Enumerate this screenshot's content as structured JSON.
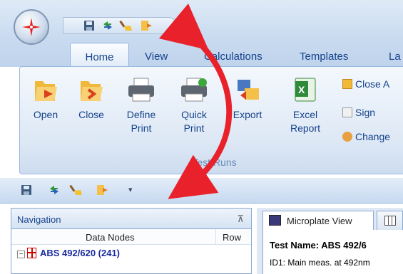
{
  "quick_access": {
    "icons": [
      "save-icon",
      "refresh-icon",
      "broom-icon",
      "close-document-icon"
    ],
    "dropdown_glyph": "▾"
  },
  "tabs": [
    {
      "label": "Home",
      "active": true
    },
    {
      "label": "View"
    },
    {
      "label": "Calculations"
    },
    {
      "label": "Templates"
    },
    {
      "label": "La"
    }
  ],
  "ribbon": {
    "buttons": [
      {
        "label": "Open",
        "icon": "open-folder-icon"
      },
      {
        "label": "Close",
        "icon": "close-folder-icon"
      },
      {
        "label": "Define Print",
        "line1": "Define",
        "line2": "Print",
        "icon": "printer-icon"
      },
      {
        "label": "Quick Print",
        "line1": "Quick",
        "line2": "Print",
        "icon": "quick-printer-icon"
      },
      {
        "label": "Export",
        "icon": "export-icon"
      },
      {
        "label": "Excel Report",
        "line1": "Excel",
        "line2": "Report",
        "icon": "excel-icon"
      }
    ],
    "small_buttons": [
      {
        "label": "Close A",
        "icon": "close-all-icon"
      },
      {
        "label": "Sign",
        "icon": "sign-icon"
      },
      {
        "label": "Change",
        "icon": "users-icon"
      }
    ],
    "group_label": "Test Runs"
  },
  "navigation": {
    "title": "Navigation",
    "columns": [
      "Data Nodes",
      "Row"
    ],
    "node": "ABS 492/620 (241)"
  },
  "view_panel": {
    "tab_label": "Microplate View",
    "test_name": "Test Name: ABS 492/6",
    "id1": "ID1: Main meas. at 492nm"
  },
  "colors": {
    "arrow": "#e8212a",
    "accent": "#15428b"
  }
}
